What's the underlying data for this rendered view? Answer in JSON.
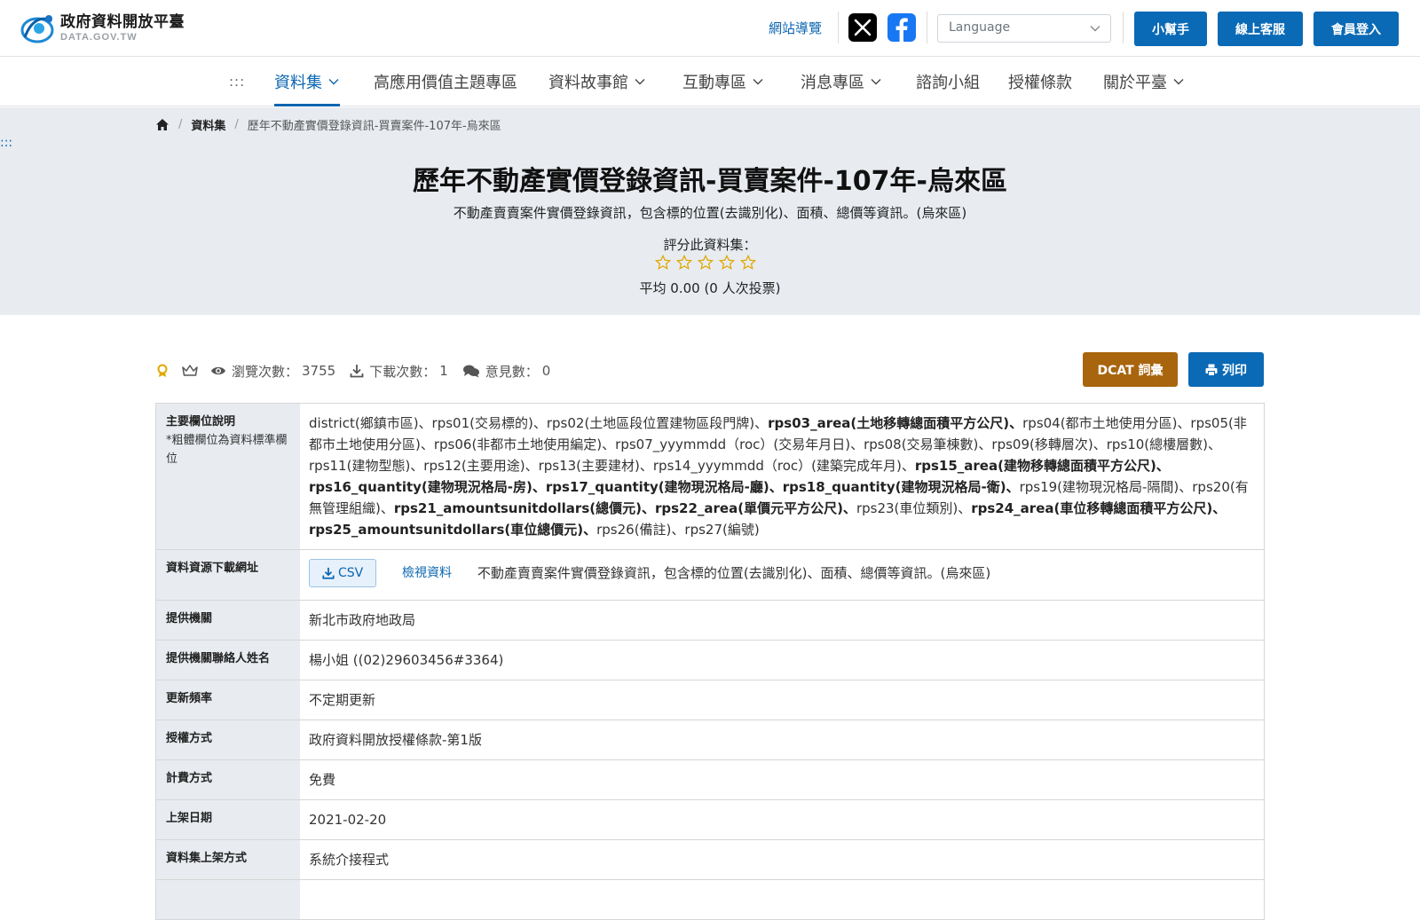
{
  "header": {
    "logo_cn": "政府資料開放平臺",
    "logo_en": "DATA.GOV.TW",
    "site_nav": "網站導覽",
    "language_placeholder": "Language",
    "buttons": {
      "helper": "小幫手",
      "support": "線上客服",
      "login": "會員登入"
    }
  },
  "nav": {
    "accesskey": ":::",
    "items": [
      "資料集",
      "高應用價值主題專區",
      "資料故事館",
      "互動專區",
      "消息專區",
      "諮詢小組",
      "授權條款",
      "關於平臺"
    ]
  },
  "breadcrumb": {
    "datasets": "資料集",
    "current": "歷年不動產實價登錄資訊-買賣案件-107年-烏來區"
  },
  "hero": {
    "accesskey": ":::",
    "title": "歷年不動產實價登錄資訊-買賣案件-107年-烏來區",
    "description": "不動產賣賣案件實價登錄資訊，包含標的位置(去識別化)、面積、總價等資訊。(烏來區)",
    "rate_label": "評分此資料集：",
    "average": "平均 0.00 (0 人次投票)"
  },
  "stats": {
    "views_label": "瀏覽次數：",
    "views": "3755",
    "downloads_label": "下載次數：",
    "downloads": "1",
    "comments_label": "意見數：",
    "comments": "0",
    "dcat_button": "DCAT 詞彙",
    "print_button": "列印"
  },
  "table": {
    "fields_header": "主要欄位說明",
    "fields_note": "*粗體欄位為資料標準欄位",
    "fields_parts": [
      {
        "t": "district(鄉鎮市區)、rps01(交易標的)、rps02(土地區段位置建物區段門牌)、",
        "b": false
      },
      {
        "t": "rps03_area(土地移轉總面積平方公尺)、",
        "b": true
      },
      {
        "t": "rps04(都市土地使用分區)、rps05(非都市土地使用分區)、rps06(非都市土地使用編定)、rps07_yyymmdd（roc）(交易年月日)、rps08(交易筆棟數)、rps09(移轉層次)、rps10(總樓層數)、rps11(建物型態)、rps12(主要用途)、rps13(主要建材)、rps14_yyymmdd（roc）(建築完成年月)、",
        "b": false
      },
      {
        "t": "rps15_area(建物移轉總面積平方公尺)、rps16_quantity(建物現況格局-房)、rps17_quantity(建物現況格局-廳)、rps18_quantity(建物現況格局-衛)、",
        "b": true
      },
      {
        "t": "rps19(建物現況格局-隔間)、rps20(有無管理組織)、",
        "b": false
      },
      {
        "t": "rps21_amountsunitdollars(總價元)、rps22_area(單價元平方公尺)、",
        "b": true
      },
      {
        "t": "rps23(車位類別)、",
        "b": false
      },
      {
        "t": "rps24_area(車位移轉總面積平方公尺)、rps25_amountsunitdollars(車位總價元)、",
        "b": true
      },
      {
        "t": "rps26(備註)、rps27(編號)",
        "b": false
      }
    ],
    "resource_header": "資料資源下載網址",
    "csv_label": "CSV",
    "view_label": "檢視資料",
    "resource_desc": "不動產賣賣案件實價登錄資訊，包含標的位置(去識別化)、面積、總價等資訊。(烏來區)",
    "provider_header": "提供機關",
    "provider": "新北市政府地政局",
    "contact_header": "提供機關聯絡人姓名",
    "contact": "楊小姐 ((02)29603456#3364)",
    "frequency_header": "更新頻率",
    "frequency": "不定期更新",
    "license_header": "授權方式",
    "license": "政府資料開放授權條款-第1版",
    "fee_header": "計費方式",
    "fee": "免費",
    "date_header": "上架日期",
    "date": "2021-02-20",
    "method_header": "資料集上架方式",
    "method": "系統介接程式"
  },
  "colors": {
    "primary": "#0b6ab5",
    "dcat": "#a8650d",
    "hero_bg": "#e8ecf1",
    "star": "#e0a800"
  }
}
